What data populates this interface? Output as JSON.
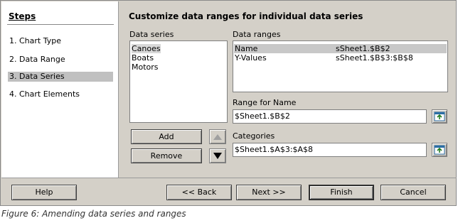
{
  "steps": {
    "title": "Steps",
    "items": [
      {
        "label": "1. Chart Type"
      },
      {
        "label": "2. Data Range"
      },
      {
        "label": "3. Data Series"
      },
      {
        "label": "4. Chart Elements"
      }
    ]
  },
  "main": {
    "title": "Customize data ranges for individual data series",
    "data_series_label": "Data series",
    "data_series": [
      "Canoes",
      "Boats",
      "Motors"
    ],
    "data_ranges_label": "Data ranges",
    "data_ranges": [
      {
        "name": "Name",
        "range": "sSheet1.$B$2"
      },
      {
        "name": "Y-Values",
        "range": "sSheet1.$B$3:$B$8"
      }
    ],
    "range_for_name_label": "Range for Name",
    "range_for_name_value": "$Sheet1.$B$2",
    "categories_label": "Categories",
    "categories_value": "$Sheet1.$A$3:$A$8",
    "add_label": "Add",
    "remove_label": "Remove"
  },
  "footer": {
    "help": "Help",
    "back": "<< Back",
    "next": "Next >>",
    "finish": "Finish",
    "cancel": "Cancel"
  },
  "caption": "Figure 6: Amending data series and ranges"
}
